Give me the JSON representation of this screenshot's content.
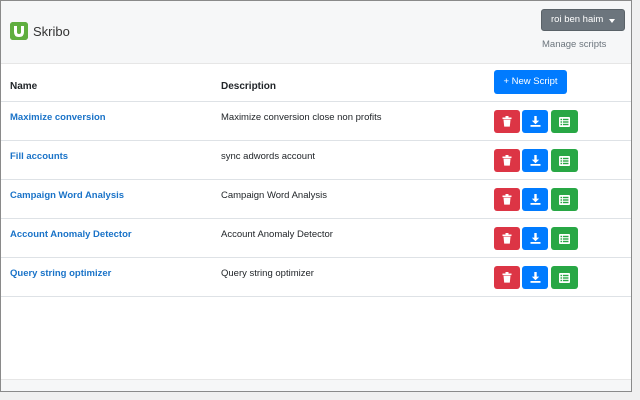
{
  "app": {
    "title": "Skribo"
  },
  "header": {
    "user_label": "roi ben haim",
    "manage_link": "Manage scripts"
  },
  "table": {
    "col_name": "Name",
    "col_description": "Description",
    "new_button": "+ New Script",
    "rows": [
      {
        "name": "Maximize conversion",
        "description": "Maximize conversion close non profits"
      },
      {
        "name": "Fill accounts",
        "description": "sync adwords account"
      },
      {
        "name": "Campaign Word Analysis",
        "description": "Campaign Word Analysis"
      },
      {
        "name": "Account Anomaly Detector",
        "description": "Account Anomaly Detector"
      },
      {
        "name": "Query string optimizer",
        "description": "Query string optimizer"
      }
    ]
  },
  "colors": {
    "danger": "#dc3545",
    "primary": "#007bff",
    "success": "#28a745",
    "link": "#1a73c8",
    "brand": "#5fae3f"
  },
  "icons": {
    "delete": "trash-icon",
    "download": "download-icon",
    "edit": "list-icon"
  }
}
